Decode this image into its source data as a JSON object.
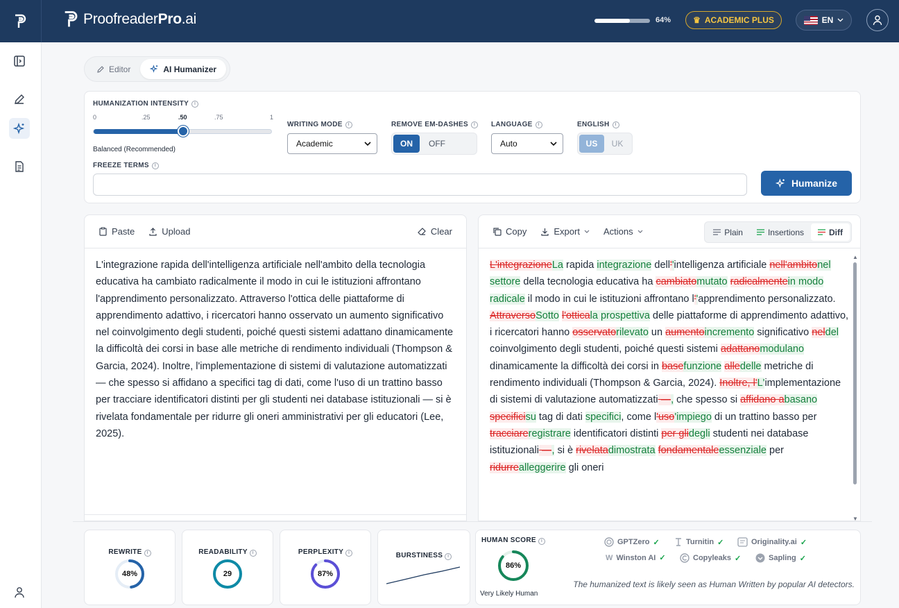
{
  "header": {
    "brand_main": "Proofreader",
    "brand_bold": "Pro",
    "brand_suffix": ".ai",
    "usage_percent": 64,
    "usage_label": "64%",
    "plan_label": "ACADEMIC PLUS",
    "language_label": "EN"
  },
  "tabs": {
    "editor": "Editor",
    "humanizer": "AI Humanizer"
  },
  "settings": {
    "intensity_label": "HUMANIZATION INTENSITY",
    "ticks": [
      "0",
      ".25",
      ".50",
      ".75",
      "1"
    ],
    "intensity_value": 0.5,
    "intensity_caption": "Balanced (Recommended)",
    "writing_mode_label": "WRITING MODE",
    "writing_mode_value": "Academic",
    "em_dash_label": "REMOVE EM-DASHES",
    "on": "ON",
    "off": "OFF",
    "language_label": "LANGUAGE",
    "language_value": "Auto",
    "english_label": "ENGLISH",
    "us": "US",
    "uk": "UK",
    "freeze_label": "FREEZE TERMS",
    "freeze_value": "",
    "humanize_button": "Humanize"
  },
  "input_panel": {
    "paste": "Paste",
    "upload": "Upload",
    "clear": "Clear",
    "text": "L'integrazione rapida dell'intelligenza artificiale nell'ambito della tecnologia educativa ha cambiato radicalmente il modo in cui le istituzioni affrontano l'apprendimento personalizzato. Attraverso l'ottica delle piattaforme di apprendimento adattivo, i ricercatori hanno osservato un aumento significativo nel coinvolgimento degli studenti, poiché questi sistemi adattano dinamicamente la difficoltà dei corsi in base alle metriche di rendimento individuali (Thompson & Garcia, 2024). Inoltre, l'implementazione di sistemi di valutazione automatizzati — che spesso si affidano a specifici tag di dati, come l'uso di un trattino basso per tracciare identificatori distinti per gli studenti nei database istituzionali — si è rivelata fondamentale per ridurre gli oneri amministrativi per gli educatori (Lee, 2025)."
  },
  "output_panel": {
    "copy": "Copy",
    "export": "Export",
    "actions": "Actions",
    "view_plain": "Plain",
    "view_insertions": "Insertions",
    "view_diff": "Diff",
    "diff": [
      {
        "t": "d",
        "s": "L'integrazione"
      },
      {
        "t": "i",
        "s": "La"
      },
      {
        "t": "n",
        "s": " rapida "
      },
      {
        "t": "i",
        "s": "integrazione"
      },
      {
        "t": "n",
        "s": " dell"
      },
      {
        "t": "d",
        "s": "'"
      },
      {
        "t": "i",
        "s": "'"
      },
      {
        "t": "n",
        "s": "intelligenza artificiale "
      },
      {
        "t": "d",
        "s": "nell'ambito"
      },
      {
        "t": "i",
        "s": "nel settore"
      },
      {
        "t": "n",
        "s": " della tecnologia educativa ha "
      },
      {
        "t": "d",
        "s": "cambiato"
      },
      {
        "t": "i",
        "s": "mutato"
      },
      {
        "t": "n",
        "s": " "
      },
      {
        "t": "d",
        "s": "radicalmente"
      },
      {
        "t": "i",
        "s": "in modo radicale"
      },
      {
        "t": "n",
        "s": " il modo in cui le istituzioni affrontano l"
      },
      {
        "t": "d",
        "s": "'"
      },
      {
        "t": "i",
        "s": "'"
      },
      {
        "t": "n",
        "s": "apprendimento personalizzato. "
      },
      {
        "t": "d",
        "s": "Attraverso"
      },
      {
        "t": "i",
        "s": "Sotto"
      },
      {
        "t": "n",
        "s": " "
      },
      {
        "t": "d",
        "s": "l'ottica"
      },
      {
        "t": "i",
        "s": "la prospettiva"
      },
      {
        "t": "n",
        "s": " delle piattaforme di apprendimento adattivo, i ricercatori hanno "
      },
      {
        "t": "d",
        "s": "osservato"
      },
      {
        "t": "i",
        "s": "rilevato"
      },
      {
        "t": "n",
        "s": " un "
      },
      {
        "t": "d",
        "s": "aumento"
      },
      {
        "t": "i",
        "s": "incremento"
      },
      {
        "t": "n",
        "s": " significativo "
      },
      {
        "t": "d",
        "s": "nel"
      },
      {
        "t": "i",
        "s": "del"
      },
      {
        "t": "n",
        "s": " coinvolgimento degli studenti, poiché questi sistemi "
      },
      {
        "t": "d",
        "s": "adattano"
      },
      {
        "t": "i",
        "s": "modulano"
      },
      {
        "t": "n",
        "s": " dinamicamente la difficoltà dei corsi in "
      },
      {
        "t": "d",
        "s": "base"
      },
      {
        "t": "i",
        "s": "funzione"
      },
      {
        "t": "n",
        "s": " "
      },
      {
        "t": "d",
        "s": "alle"
      },
      {
        "t": "i",
        "s": "delle"
      },
      {
        "t": "n",
        "s": " metriche di rendimento individuali (Thompson & Garcia, 2024). "
      },
      {
        "t": "d",
        "s": "Inoltre, l'"
      },
      {
        "t": "i",
        "s": "L'"
      },
      {
        "t": "n",
        "s": "implementazione di sistemi di valutazione automatizzati"
      },
      {
        "t": "d",
        "s": " —"
      },
      {
        "t": "i",
        "s": ","
      },
      {
        "t": "n",
        "s": " che spesso si "
      },
      {
        "t": "d",
        "s": "affidano a"
      },
      {
        "t": "i",
        "s": "basano"
      },
      {
        "t": "n",
        "s": " "
      },
      {
        "t": "d",
        "s": "specifici"
      },
      {
        "t": "i",
        "s": "su"
      },
      {
        "t": "n",
        "s": " tag di dati "
      },
      {
        "t": "i",
        "s": "specifici"
      },
      {
        "t": "n",
        "s": ", come l"
      },
      {
        "t": "d",
        "s": "'uso"
      },
      {
        "t": "i",
        "s": "'impiego"
      },
      {
        "t": "n",
        "s": " di un trattino basso per "
      },
      {
        "t": "d",
        "s": "tracciare"
      },
      {
        "t": "i",
        "s": "registrare"
      },
      {
        "t": "n",
        "s": " identificatori distinti "
      },
      {
        "t": "d",
        "s": "per gli"
      },
      {
        "t": "i",
        "s": "degli"
      },
      {
        "t": "n",
        "s": " studenti nei database istituzionali"
      },
      {
        "t": "d",
        "s": " —"
      },
      {
        "t": "i",
        "s": ","
      },
      {
        "t": "n",
        "s": " si è "
      },
      {
        "t": "d",
        "s": "rivelata"
      },
      {
        "t": "i",
        "s": "dimostrata"
      },
      {
        "t": "n",
        "s": " "
      },
      {
        "t": "d",
        "s": "fondamentale"
      },
      {
        "t": "i",
        "s": "essenziale"
      },
      {
        "t": "n",
        "s": " per "
      },
      {
        "t": "d",
        "s": "ridurre"
      },
      {
        "t": "i",
        "s": "alleggerire"
      },
      {
        "t": "n",
        "s": " gli oneri"
      }
    ]
  },
  "metrics": {
    "rewrite_label": "REWRITE",
    "rewrite_value": "48%",
    "rewrite": 0.48,
    "readability_label": "READABILITY",
    "readability_value": "29",
    "readability": 1.0,
    "perplexity_label": "PERPLEXITY",
    "perplexity_value": "87%",
    "perplexity": 0.87,
    "burstiness_label": "BURSTINESS",
    "human_label": "HUMAN SCORE",
    "human_value": "86%",
    "human": 0.86,
    "human_caption": "Very Likely Human",
    "detectors": [
      "GPTZero",
      "Turnitin",
      "Originality.ai",
      "Winston AI",
      "Copyleaks",
      "Sapling"
    ],
    "detector_note": "The humanized text is likely seen as Human Written by popular AI detectors.",
    "colors": {
      "rewrite": "#2563a8",
      "readability": "#0e8aa6",
      "perplexity": "#5b4fd6",
      "human": "#16875a"
    }
  }
}
